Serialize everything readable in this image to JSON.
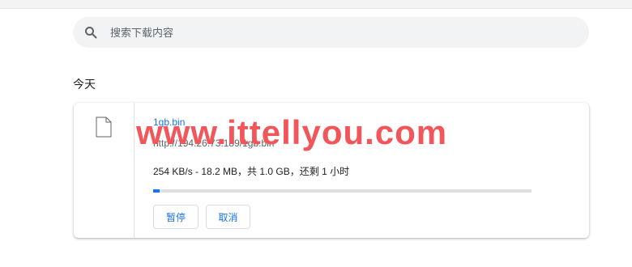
{
  "search": {
    "placeholder": "搜索下载内容",
    "icon": "search-icon"
  },
  "section": {
    "title": "今天"
  },
  "download": {
    "file_icon": "file-icon",
    "file_name": "1gb.bin",
    "url": "http://194.26.73.189/1gb.bin",
    "progress_text": "254 KB/s - 18.2 MB，共 1.0 GB，还剩 1 小时",
    "progress_fraction": 0.018,
    "pause_label": "暂停",
    "cancel_label": "取消"
  },
  "watermark": {
    "text": "www.ittellyou.com"
  },
  "colors": {
    "accent": "#1a73e8",
    "watermark": "#f2555a",
    "search_bg": "#f1f3f4"
  }
}
